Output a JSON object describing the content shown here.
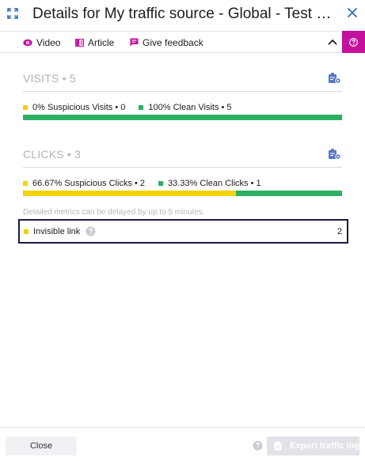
{
  "window": {
    "title": "Details for My traffic source - Global - Test Campaign",
    "expand_icon": "expand-icon",
    "close_icon": "close-icon"
  },
  "toolbar": {
    "video_label": "Video",
    "article_label": "Article",
    "feedback_label": "Give feedback",
    "collapse_icon": "chevron-up-icon",
    "help_icon": "question-icon",
    "accent": "#c4119c"
  },
  "visits": {
    "title": "VISITS • 5",
    "suspicious_label": "0% Suspicious Visits • 0",
    "clean_label": "100% Clean Visits • 5",
    "suspicious_pct": 0,
    "clean_pct": 100
  },
  "clicks": {
    "title": "CLICKS • 3",
    "suspicious_label": "66.67% Suspicious Clicks • 2",
    "clean_label": "33.33% Clean Clicks • 1",
    "suspicious_pct": 66.67,
    "clean_pct": 33.33
  },
  "note": "Detailed metrics can be delayed by up to 5 minutes.",
  "detail": {
    "label": "Invisible link",
    "value": "2"
  },
  "footer": {
    "close_label": "Close",
    "export_label": "Export traffic log"
  },
  "colors": {
    "suspicious": "#f4d20d",
    "clean": "#2db062",
    "highlight_border": "#1b1841"
  }
}
